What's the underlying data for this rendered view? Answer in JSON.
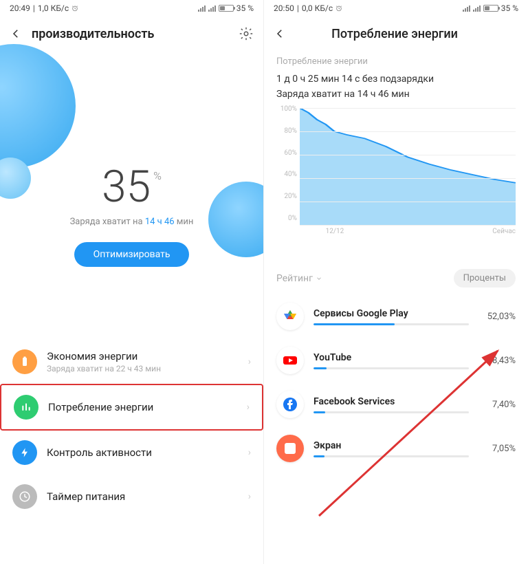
{
  "left": {
    "status": {
      "time": "20:49",
      "net": "1,0 КБ/с",
      "battery": "35 %"
    },
    "header": {
      "title": "производительность"
    },
    "hero": {
      "battery_value": "35",
      "battery_symbol": "%",
      "sub_prefix": "Заряда хватит на ",
      "sub_time": "14 ч 46",
      "sub_suffix": " мин",
      "optimize": "Оптимизировать"
    },
    "menu": [
      {
        "label": "Экономия энергии",
        "sub": "Заряда хватит на 22 ч 43 мин"
      },
      {
        "label": "Потребление энергии"
      },
      {
        "label": "Контроль активности"
      },
      {
        "label": "Таймер питания"
      }
    ]
  },
  "right": {
    "status": {
      "time": "20:50",
      "net": "0,0 КБ/с",
      "battery": "35 %"
    },
    "header": {
      "title": "Потребление энергии"
    },
    "section_label": "Потребление энергии",
    "info_line1": "1 д 0 ч 25 мин 14 с без подзарядки",
    "info_line2": "Заряда хватит на 14 ч 46 мин",
    "chart_x_start": "12/12",
    "chart_x_end": "Сейчас",
    "chart_y": [
      "100%",
      "80%",
      "60%",
      "40%",
      "20%",
      "0%"
    ],
    "sort_label": "Рейтинг",
    "sort_pill": "Проценты",
    "apps": [
      {
        "name": "Сервисы Google Play",
        "pct": "52,03%",
        "bar": 52
      },
      {
        "name": "YouTube",
        "pct": "8,43%",
        "bar": 8.4
      },
      {
        "name": "Facebook Services",
        "pct": "7,40%",
        "bar": 7.4
      },
      {
        "name": "Экран",
        "pct": "7,05%",
        "bar": 7.1
      }
    ]
  },
  "chart_data": {
    "type": "area",
    "title": "",
    "xlabel": "",
    "ylabel": "",
    "ylim": [
      0,
      100
    ],
    "y_ticks": [
      0,
      20,
      40,
      60,
      80,
      100
    ],
    "x_ticks": [
      "12/12",
      "Сейчас"
    ],
    "series": [
      {
        "name": "battery_pct",
        "x": [
          0,
          4,
          8,
          12,
          16,
          22,
          30,
          40,
          50,
          60,
          70,
          80,
          90,
          100
        ],
        "values": [
          100,
          96,
          90,
          86,
          80,
          77,
          74,
          67,
          58,
          52,
          47,
          43,
          39,
          36
        ]
      }
    ]
  }
}
